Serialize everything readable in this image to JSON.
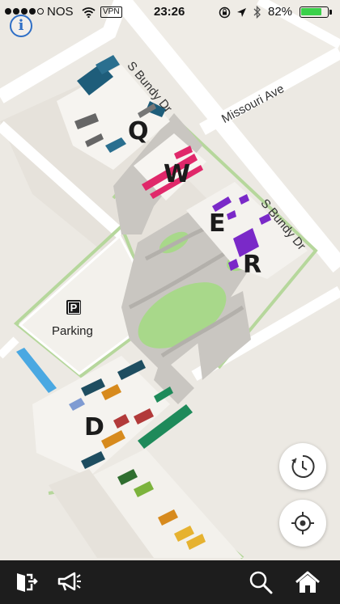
{
  "status_bar": {
    "carrier": "NOS",
    "vpn": "VPN",
    "time": "23:26",
    "battery_percent": "82%",
    "battery_level": 0.82,
    "signal_bars": 4
  },
  "map": {
    "streets": [
      "S Bundy Dr",
      "Missouri Ave",
      "S Bundy Dr"
    ],
    "buildings": [
      "Q",
      "W",
      "E",
      "R",
      "D"
    ],
    "parking": {
      "label": "Parking",
      "icon_letter": "P"
    }
  },
  "controls": {
    "info_label": "i",
    "history_icon": "clock-history-icon",
    "locate_icon": "crosshair-locate-icon"
  },
  "toolbar": {
    "items": [
      "exit-icon",
      "megaphone-icon",
      "search-icon",
      "home-icon"
    ]
  },
  "colors": {
    "W": "#e0286a",
    "E": "#7a29c8",
    "accent": "#2f6fc6"
  }
}
